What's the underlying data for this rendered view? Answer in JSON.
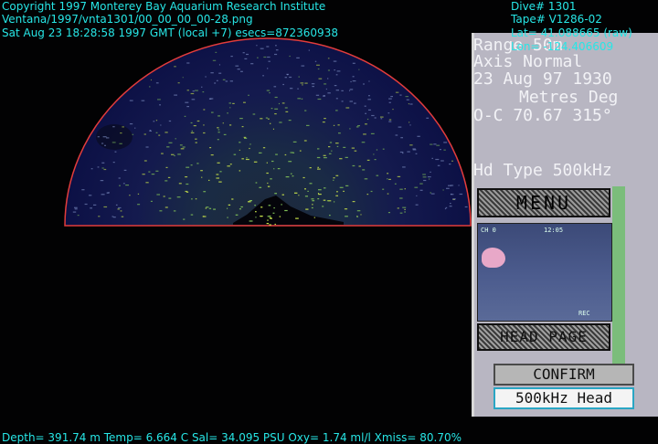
{
  "overlay": {
    "copyright": "Copyright 1997 Monterey Bay Aquarium Research Institute",
    "filepath": "Ventana/1997/vnta1301/00_00_00_00-28.png",
    "datetime": "Sat Aug 23 18:28:58 1997 GMT (local +7)  esecs=872360938",
    "dive": "Dive# 1301",
    "tape": "Tape# V1286-02",
    "lat": "Lat= 41.088665 (raw)",
    "lon": "Lon= -124.406609",
    "depth_line": "Depth= 391.74 m  Temp= 6.664 C  Sal= 34.095 PSU  Oxy= 1.74 ml/l  Xmiss= 80.70%"
  },
  "sonar_panel": {
    "range": "Range   50m",
    "axis": "Axis    Normal",
    "date": "23 Aug 97 1930",
    "units": "Metres Deg",
    "oc": "O-C 70.67 315°",
    "head_type": "Hd Type 500kHz",
    "menu_label": "MENU",
    "headpage_label": "HEAD PAGE",
    "confirm_label": "CONFIRM",
    "head_label": "500kHz Head"
  },
  "camera": {
    "tl": "CH 0",
    "tr": "12:05",
    "br": "REC"
  },
  "colors": {
    "overlay_text": "#27e6e6",
    "sonar_arc": "#e23c3c",
    "sonar_fill": "#0c1045",
    "echo": "#c8e24a"
  }
}
